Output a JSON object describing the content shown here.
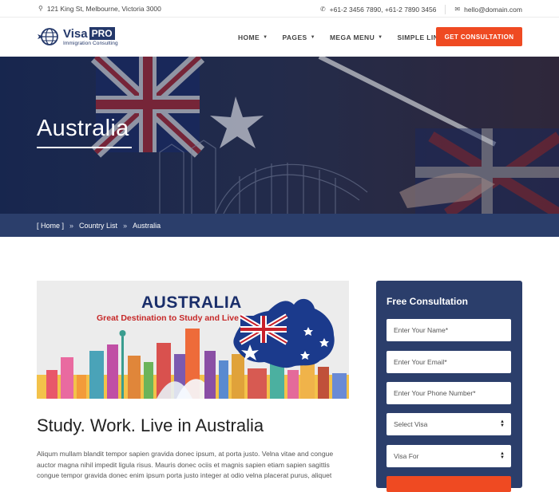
{
  "topbar": {
    "address": "121 King St, Melbourne, Victoria 3000",
    "phones": "+61-2 3456 7890,   +61-2 7890 3456",
    "email": "hello@domain.com",
    "icons": [
      "map-pin-icon",
      "phone-icon",
      "envelope-icon"
    ]
  },
  "logo": {
    "visa": "Visa",
    "pro": "PRO",
    "tagline": "Immigration Consulting"
  },
  "nav": {
    "items": [
      {
        "label": "HOME",
        "dropdown": true
      },
      {
        "label": "PAGES",
        "dropdown": true
      },
      {
        "label": "MEGA MENU",
        "dropdown": true
      },
      {
        "label": "SIMPLE LINK",
        "dropdown": false
      }
    ],
    "cta": "GET CONSULTATION"
  },
  "hero": {
    "title": "Australia"
  },
  "breadcrumb": {
    "home": "[ Home ]",
    "sep": "»",
    "list": "Country List",
    "current": "Australia"
  },
  "banner": {
    "title": "AUSTRALIA",
    "subtitle": "Great Destination to Study and Live"
  },
  "main": {
    "heading": "Study. Work. Live in Australia",
    "paragraph": "Aliqum mullam blandit tempor sapien gravida donec ipsum, at porta justo. Velna vitae and congue auctor magna nihil impedit ligula risus. Mauris donec ociis et magnis sapien etiam sapien sagittis congue tempor gravida donec enim ipsum porta justo integer at odio velna placerat purus, aliquet"
  },
  "sidebar": {
    "title": "Free Consultation",
    "name_placeholder": "Enter Your Name*",
    "email_placeholder": "Enter Your Email*",
    "phone_placeholder": "Enter Your Phone Number*",
    "visa_select": "Select Visa",
    "visa_for_select": "Visa For"
  },
  "colors": {
    "navy": "#2b3e6b",
    "accent": "#ef4a22",
    "brand": "#24386a"
  }
}
